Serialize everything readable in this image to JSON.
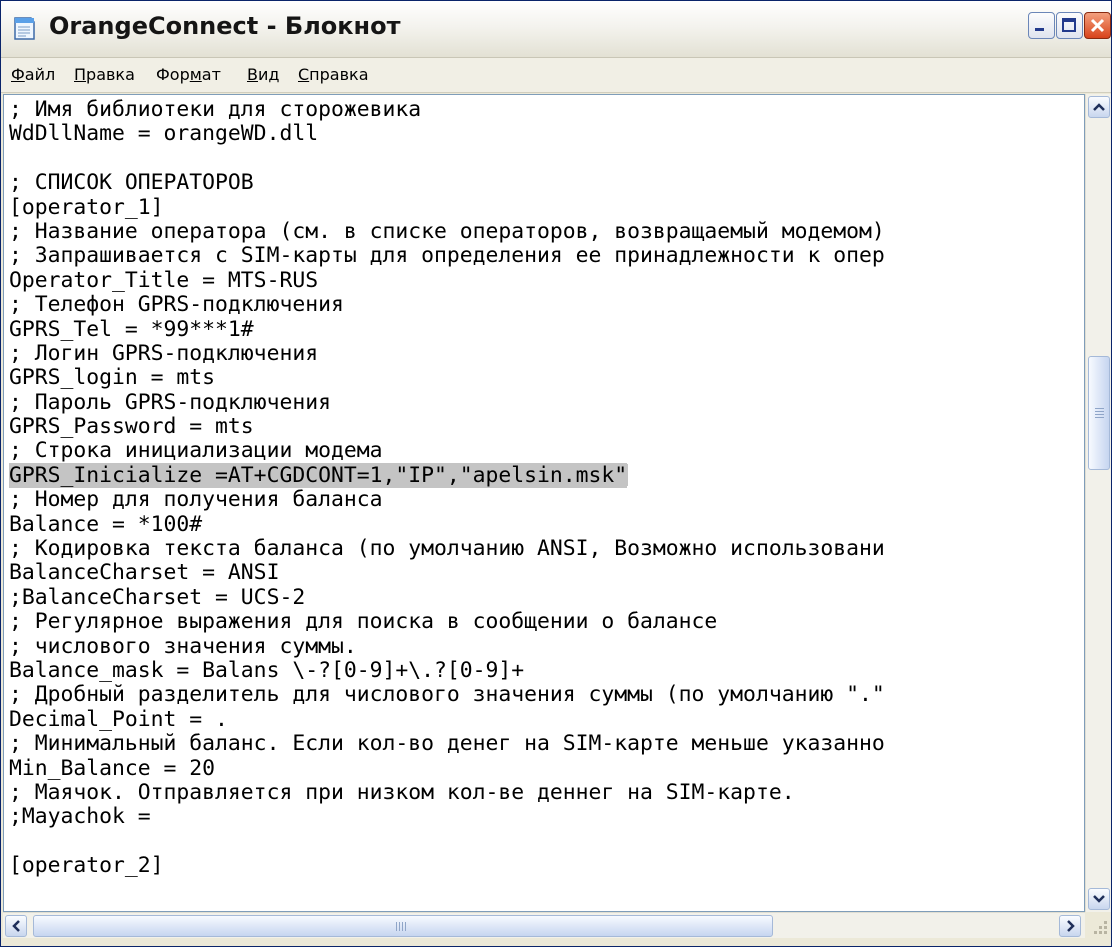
{
  "window": {
    "title": "OrangeConnect - Блокнот",
    "icon": "notepad-icon"
  },
  "menu": [
    {
      "pre": "",
      "hk": "Ф",
      "post": "айл"
    },
    {
      "pre": "",
      "hk": "П",
      "post": "равка"
    },
    {
      "pre": "Фор",
      "hk": "м",
      "post": "ат"
    },
    {
      "pre": "",
      "hk": "В",
      "post": "ид"
    },
    {
      "pre": "",
      "hk": "С",
      "post": "правка"
    }
  ],
  "editor": {
    "lines": [
      "; Имя библиотеки для сторожевика",
      "WdDllName = orangeWD.dll",
      "",
      "; СПИСОК ОПЕРАТОРОВ",
      "[operator_1]",
      "; Название оператора (см. в списке операторов, возвращаемый модемом)",
      "; Запрашивается с SIM-карты для определения ее принадлежности к опер",
      "Operator_Title = MTS-RUS",
      "; Телефон GPRS-подключения",
      "GPRS_Tel = *99***1#",
      "; Логин GPRS-подключения",
      "GPRS_login = mts",
      "; Пароль GPRS-подключения",
      "GPRS_Password = mts",
      "; Строка инициализации модема",
      "GPRS_Inicialize =AT+CGDCONT=1,\"IP\",\"apelsin.msk\"",
      "; Номер для получения баланса",
      "Balance = *100#",
      "; Кодировка текста баланса (по умолчанию ANSI, Возможно использовани",
      "BalanceCharset = ANSI",
      ";BalanceCharset = UCS-2",
      "; Регулярное выражения для поиска в сообщении о балансе",
      "; числового значения суммы.",
      "Balance_mask = Balans \\-?[0-9]+\\.?[0-9]+",
      "; Дробный разделитель для числового значения суммы (по умолчанию \".\"",
      "Decimal_Point = .",
      "; Минимальный баланс. Если кол-во денег на SIM-карте меньше указанно",
      "Min_Balance = 20",
      "; Маячок. Отправляется при низком кол-ве деннег на SIM-карте.",
      ";Mayachok =",
      "",
      "[operator_2]"
    ],
    "selected_line": 15
  },
  "colors": {
    "selection": "#c4c4c4",
    "title_text": "#151515",
    "close_button": "#d8431b"
  }
}
